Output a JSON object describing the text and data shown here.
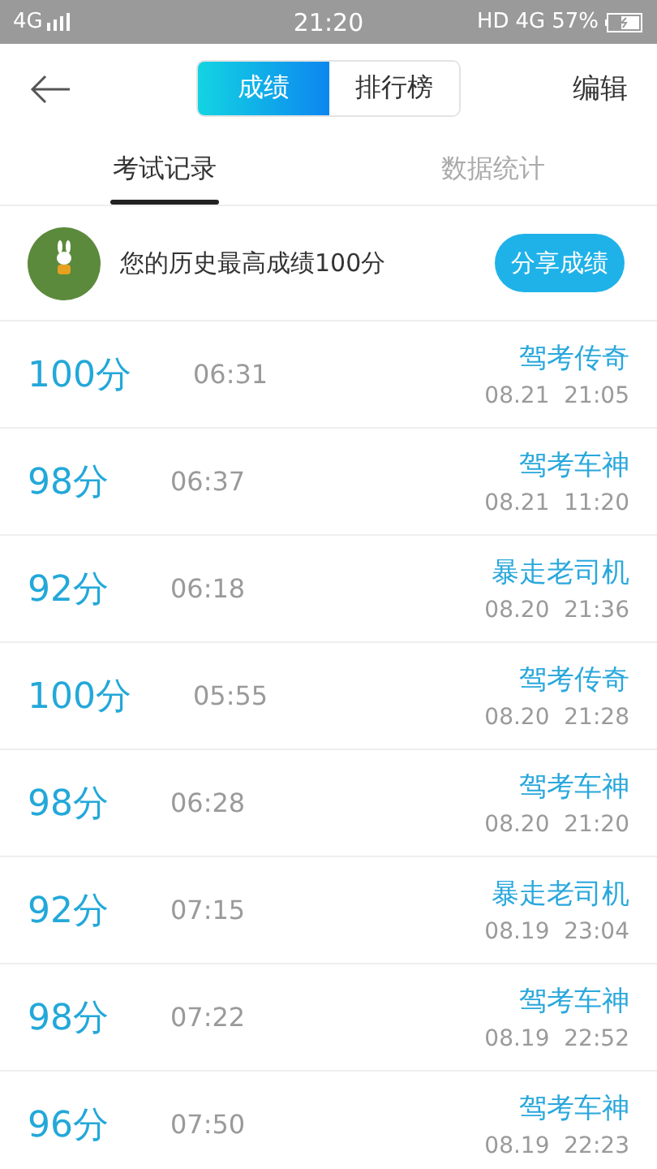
{
  "status_bar": {
    "network": "4G",
    "time": "21:20",
    "hd": "HD",
    "network_right": "4G",
    "battery": "57%"
  },
  "header": {
    "segments": [
      {
        "label": "成绩",
        "selected": true
      },
      {
        "label": "排行榜",
        "selected": false
      }
    ],
    "action": "编辑"
  },
  "tabs": [
    {
      "label": "考试记录",
      "selected": true
    },
    {
      "label": "数据统计",
      "selected": false
    }
  ],
  "banner": {
    "text": "您的历史最高成绩100分",
    "button": "分享成绩"
  },
  "records": [
    {
      "score": "100分",
      "duration": "06:31",
      "title": "驾考传奇",
      "datetime": "08.21  21:05"
    },
    {
      "score": "98分",
      "duration": "06:37",
      "title": "驾考车神",
      "datetime": "08.21  11:20"
    },
    {
      "score": "92分",
      "duration": "06:18",
      "title": "暴走老司机",
      "datetime": "08.20  21:36"
    },
    {
      "score": "100分",
      "duration": "05:55",
      "title": "驾考传奇",
      "datetime": "08.20  21:28"
    },
    {
      "score": "98分",
      "duration": "06:28",
      "title": "驾考车神",
      "datetime": "08.20  21:20"
    },
    {
      "score": "92分",
      "duration": "07:15",
      "title": "暴走老司机",
      "datetime": "08.19  23:04"
    },
    {
      "score": "98分",
      "duration": "07:22",
      "title": "驾考车神",
      "datetime": "08.19  22:52"
    },
    {
      "score": "96分",
      "duration": "07:50",
      "title": "驾考车神",
      "datetime": "08.19  22:23"
    }
  ]
}
